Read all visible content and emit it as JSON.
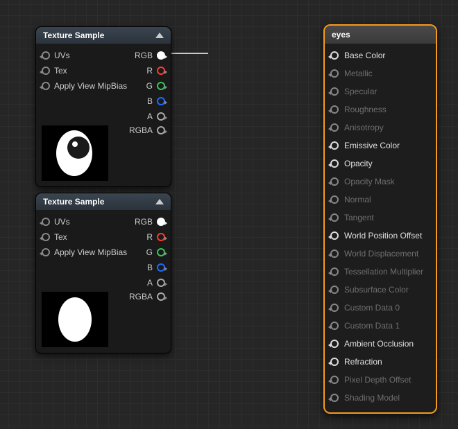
{
  "nodes": [
    {
      "title": "Texture Sample",
      "inputs": [
        "UVs",
        "Tex",
        "Apply View MipBias"
      ],
      "outputs": [
        {
          "label": "RGB",
          "color": "#ffffff",
          "filled": true
        },
        {
          "label": "R",
          "color": "#ff3b30",
          "filled": false
        },
        {
          "label": "G",
          "color": "#34c759",
          "filled": false
        },
        {
          "label": "B",
          "color": "#1e6bff",
          "filled": false
        },
        {
          "label": "A",
          "color": "#aaaaaa",
          "filled": false
        },
        {
          "label": "RGBA",
          "color": "#aaaaaa",
          "filled": false
        }
      ],
      "thumb": "eye_texture"
    },
    {
      "title": "Texture Sample",
      "inputs": [
        "UVs",
        "Tex",
        "Apply View MipBias"
      ],
      "outputs": [
        {
          "label": "RGB",
          "color": "#ffffff",
          "filled": true
        },
        {
          "label": "R",
          "color": "#ff3b30",
          "filled": false
        },
        {
          "label": "G",
          "color": "#34c759",
          "filled": false
        },
        {
          "label": "B",
          "color": "#1e6bff",
          "filled": false
        },
        {
          "label": "A",
          "color": "#aaaaaa",
          "filled": false
        },
        {
          "label": "RGBA",
          "color": "#aaaaaa",
          "filled": false
        }
      ],
      "thumb": "oval_mask"
    }
  ],
  "material": {
    "title": "eyes",
    "pins": [
      {
        "label": "Base Color",
        "enabled": true
      },
      {
        "label": "Metallic",
        "enabled": false
      },
      {
        "label": "Specular",
        "enabled": false
      },
      {
        "label": "Roughness",
        "enabled": false
      },
      {
        "label": "Anisotropy",
        "enabled": false
      },
      {
        "label": "Emissive Color",
        "enabled": true
      },
      {
        "label": "Opacity",
        "enabled": true
      },
      {
        "label": "Opacity Mask",
        "enabled": false
      },
      {
        "label": "Normal",
        "enabled": false
      },
      {
        "label": "Tangent",
        "enabled": false
      },
      {
        "label": "World Position Offset",
        "enabled": true
      },
      {
        "label": "World Displacement",
        "enabled": false
      },
      {
        "label": "Tessellation Multiplier",
        "enabled": false
      },
      {
        "label": "Subsurface Color",
        "enabled": false
      },
      {
        "label": "Custom Data 0",
        "enabled": false
      },
      {
        "label": "Custom Data 1",
        "enabled": false
      },
      {
        "label": "Ambient Occlusion",
        "enabled": true
      },
      {
        "label": "Refraction",
        "enabled": true
      },
      {
        "label": "Pixel Depth Offset",
        "enabled": false
      },
      {
        "label": "Shading Model",
        "enabled": false
      }
    ]
  }
}
